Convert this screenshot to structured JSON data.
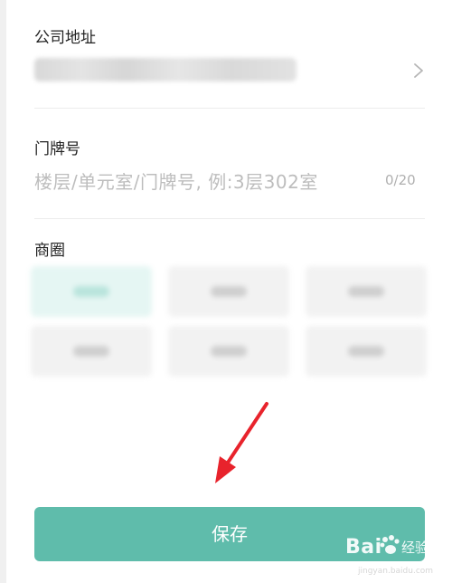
{
  "address_section": {
    "label": "公司地址",
    "value_redacted": true
  },
  "door_number_section": {
    "label": "门牌号",
    "placeholder": "楼层/单元室/门牌号, 例:3层302室",
    "counter": "0/20"
  },
  "business_district_section": {
    "label": "商圈",
    "options_redacted": true,
    "selected_index": 0
  },
  "save_button": {
    "label": "保存"
  },
  "annotation": {
    "arrow_color": "#e8232c"
  },
  "watermark": {
    "brand": "Bai",
    "sub": "经验",
    "url": "jingyan.baidu.com"
  },
  "colors": {
    "accent": "#5fbcab",
    "selected_chip": "#e5f6f3"
  }
}
